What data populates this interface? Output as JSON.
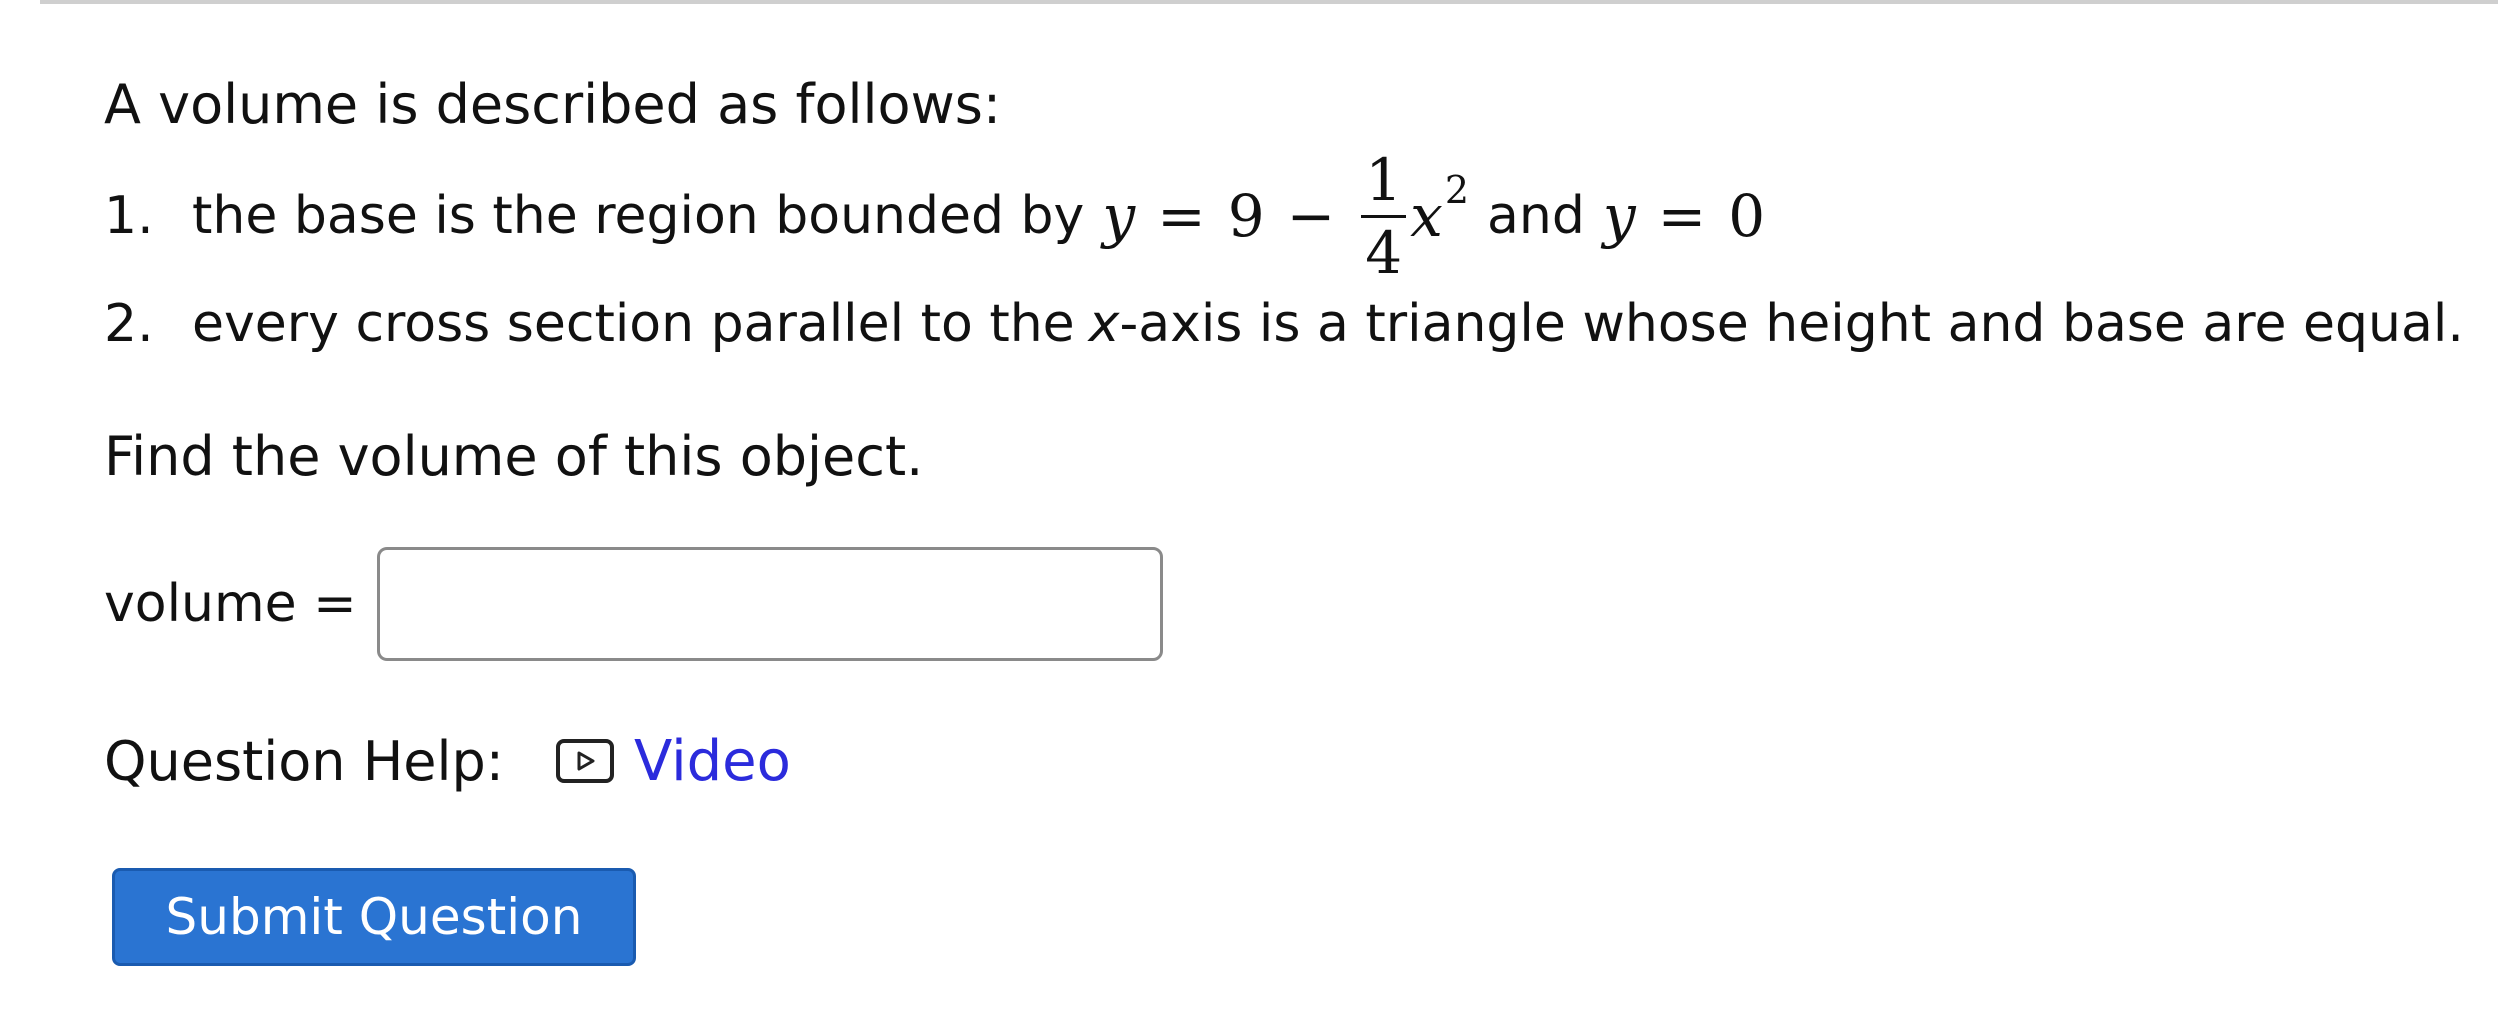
{
  "question": {
    "intro": "A volume is described as follows:",
    "items": [
      {
        "number": "1.",
        "text_before": "the base is the region bounded by",
        "eq1_lhs": "y",
        "eq1_equals": "=",
        "eq1_nine": "9",
        "eq1_minus": "−",
        "eq1_frac_num": "1",
        "eq1_frac_den": "4",
        "eq1_var": "x",
        "eq1_exp": "2",
        "text_and": "and",
        "eq2_lhs": "y",
        "eq2_equals": "=",
        "eq2_rhs": "0"
      },
      {
        "number": "2.",
        "text_before": "every cross section parallel to the",
        "axis_var": "x",
        "text_after": "-axis is a triangle whose height and base are equal."
      }
    ],
    "prompt": "Find the volume of this object."
  },
  "answer": {
    "label": "volume =",
    "value": ""
  },
  "help": {
    "label": "Question Help:",
    "icon": "video-play-icon",
    "link_label": "Video",
    "link_color": "#2b2bdc"
  },
  "submit": {
    "label": "Submit Question",
    "color": "#2a74d2"
  }
}
